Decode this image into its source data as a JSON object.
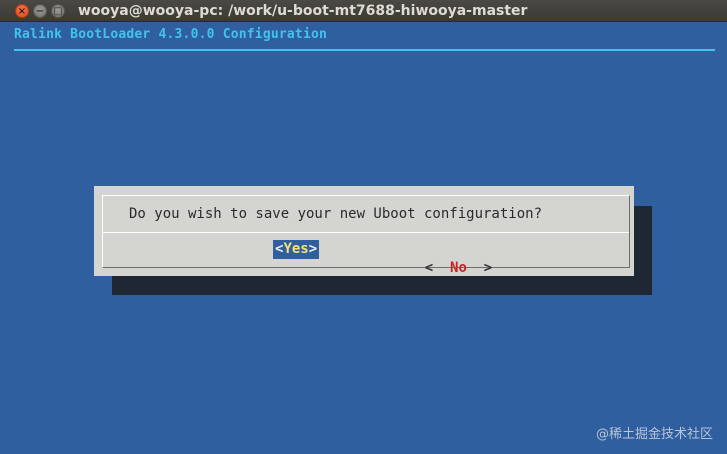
{
  "window": {
    "title": "wooya@wooya-pc: /work/u-boot-mt7688-hiwooya-master",
    "close_glyph": "×",
    "min_glyph": "−",
    "max_glyph": "□"
  },
  "app": {
    "title": "Ralink BootLoader 4.3.0.0 Configuration"
  },
  "dialog": {
    "question": "Do you wish to save your new Uboot configuration?",
    "yes_left": "<",
    "yes_first": " ",
    "yes_label": "Yes",
    "yes_right": " >",
    "no_left": "<  ",
    "no_label": "No",
    "no_right": "  >",
    "selected": "Yes"
  },
  "watermark": "@稀土掘金技术社区",
  "colors": {
    "background": "#2f5f9f",
    "title_accent": "#42c3ee",
    "dialog": "#d4d4d0",
    "no_label": "#c92424",
    "yes_label": "#f6e276"
  }
}
